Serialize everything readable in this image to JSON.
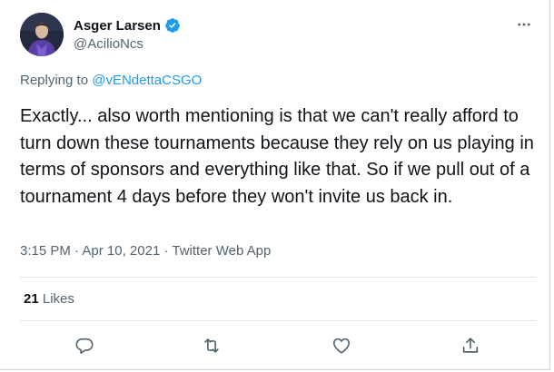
{
  "author": {
    "display_name": "Asger Larsen",
    "handle": "@AcilioNcs",
    "verified": true
  },
  "reply": {
    "prefix": "Replying to",
    "target": "@vENdettaCSGO"
  },
  "tweet": {
    "text": "Exactly... also worth mentioning is that we can't really afford to turn down these tournaments because they rely on us playing in terms of sponsors and everything like that. So if we pull out of a tournament 4 days before they won't invite us back in."
  },
  "meta": {
    "time": "3:15 PM",
    "separator": "·",
    "date": "Apr 10, 2021",
    "client": "Twitter Web App"
  },
  "stats": {
    "likes_count": "21",
    "likes_label": "Likes"
  },
  "icons": {
    "more": "more-icon",
    "verified": "verified-badge-icon",
    "reply": "reply-icon",
    "retweet": "retweet-icon",
    "like": "like-icon",
    "share": "share-icon"
  },
  "colors": {
    "accent": "#1d9bf0",
    "secondary_text": "#536471",
    "primary_text": "#0f1419"
  }
}
